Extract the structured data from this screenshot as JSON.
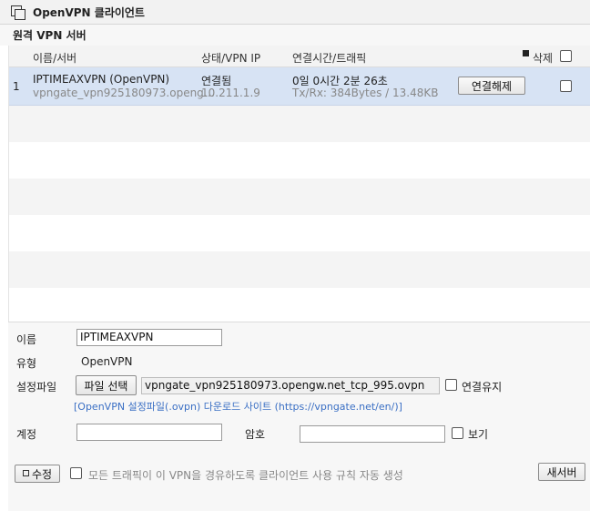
{
  "window": {
    "title": "OpenVPN 클라이언트"
  },
  "section": {
    "title": "원격 VPN 서버"
  },
  "table": {
    "headers": {
      "name_server": "이름/서버",
      "status_ip": "상태/VPN IP",
      "time_traffic": "연결시간/트래픽",
      "delete": "삭제"
    },
    "rows": [
      {
        "index": "1",
        "name": "IPTIMEAXVPN (OpenVPN)",
        "server": "vpngate_vpn925180973.openg…",
        "status": "연결됨",
        "vpn_ip": "10.211.1.9",
        "uptime": "0일 0시간 2분 26초",
        "traffic": "Tx/Rx: 384Bytes / 13.48KB",
        "action_label": "연결해제"
      }
    ]
  },
  "form": {
    "name_label": "이름",
    "name_value": "IPTIMEAXVPN",
    "type_label": "유형",
    "type_value": "OpenVPN",
    "config_label": "설정파일",
    "file_button": "파일 선택",
    "file_value": "vpngate_vpn925180973.opengw.net_tcp_995.ovpn",
    "keep_alive_label": "연결유지",
    "download_link": "[OpenVPN 설정파일(.ovpn) 다운로드 사이트 (https://vpngate.net/en/)]",
    "account_label": "계정",
    "account_value": "",
    "password_label": "암호",
    "password_value": "",
    "show_label": "보기",
    "modify_button": "수정",
    "route_all_label": "모든 트래픽이 이 VPN을 경유하도록 클라이언트 사용 규칙 자동 생성",
    "new_server_button": "새서버"
  }
}
